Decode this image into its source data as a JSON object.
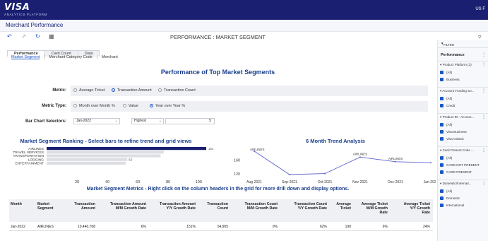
{
  "brand": {
    "logo": "VISA",
    "subtitle": "ANALYTICS PLATFORM",
    "user": "US F"
  },
  "subheader": {
    "title": "Merchant Performance"
  },
  "toolbar": {
    "back_icon": "undo-icon",
    "forward_icon": "redo-icon",
    "refresh_icon": "refresh-icon",
    "grid_icon": "grid-icon",
    "filter_icon": "funnel-icon"
  },
  "page": {
    "title": "PERFORMANCE : MARKET SEGMENT"
  },
  "tabs": [
    {
      "label": "Performance",
      "active": true
    },
    {
      "label": "Card Count",
      "active": false
    },
    {
      "label": "Data",
      "active": false
    }
  ],
  "subtabs": [
    {
      "label": "Market Segment",
      "active": true
    },
    {
      "label": "Merchant Category Code",
      "active": false
    },
    {
      "label": "Merchant",
      "active": false
    }
  ],
  "heading": "Performance of Top Market Segments",
  "controls": {
    "metric_label": "Metric:",
    "metric_options": [
      {
        "label": "Average Ticket",
        "selected": false
      },
      {
        "label": "Transaction Amount",
        "selected": true
      },
      {
        "label": "Transaction Count",
        "selected": false
      }
    ],
    "metric_type_label": "Metric Type:",
    "metric_type_options": [
      {
        "label": "Month over Month %",
        "selected": false
      },
      {
        "label": "Value",
        "selected": false
      },
      {
        "label": "Year over Year %",
        "selected": true
      }
    ],
    "bar_selectors_label": "Bar Chart Selectors:",
    "month_value": "Jan-2022",
    "order_value": "Highest",
    "count_value": "5"
  },
  "ranking": {
    "title": "Market Segment Ranking - Select bars to refine trend and grid views",
    "categories": [
      "AIRLINES",
      "TRAVEL SERVICES",
      "TRANSPORTATION",
      "LODGING",
      "ENTERTAINMENT"
    ],
    "values": [
      151,
      77,
      75,
      53,
      52
    ],
    "value_label": "151",
    "lodging_label": "53",
    "ticks": [
      "20",
      "40",
      "60",
      "80",
      "100"
    ],
    "xlim": [
      0,
      105
    ]
  },
  "trend": {
    "title": "6 Month Trend Analysis",
    "y_ticks": [
      "160",
      "120"
    ],
    "x_labels": [
      "Aug-2021",
      "Sep-2021",
      "Oct-2021",
      "Nov-2021",
      "Dec-2021",
      "Jan-2022"
    ],
    "values": [
      185,
      118,
      121,
      168,
      155,
      152
    ],
    "ylim": [
      110,
      195
    ],
    "point_labels": {
      "first": "AIRLINES",
      "nov": "AIRLINES",
      "dec": "AIRLINES"
    }
  },
  "metrics": {
    "title": "Market Segment Metrics - Right click on the column headers in the grid for more drill down and display options.",
    "headers": [
      [
        "Month"
      ],
      [
        "Market",
        "Segment"
      ],
      [
        "Transaction",
        "Amount"
      ],
      [
        "Transaction Amount",
        "M/M Growth Rate"
      ],
      [
        "Transaction Amount",
        "Y/Y Growth Rate"
      ],
      [
        "Transaction",
        "Count"
      ],
      [
        "Transaction Count",
        "M/M Growth Rate"
      ],
      [
        "Transaction Count",
        "Y/Y Growth Rate"
      ],
      [
        "Average",
        "Ticket"
      ],
      [
        "Average Ticket",
        "M/M Growth",
        "Rate"
      ],
      [
        "Average Ticket",
        "Y/Y Growth",
        "Rate"
      ]
    ],
    "rows": [
      [
        "Jan-2022",
        "AIRLINES",
        "10,440,768",
        "6%",
        "151%",
        "54,905",
        "0%",
        "62%",
        "190",
        "6%",
        "24%"
      ]
    ]
  },
  "filter": {
    "header": "FILTER",
    "section": "Performance",
    "groups": [
      {
        "title": "Product Platform (2)",
        "items": [
          "(All)",
          "Business"
        ]
      },
      {
        "title": "Account Funding So...",
        "items": [
          "(All)",
          "Credit"
        ]
      },
      {
        "title": "Product ID - Accoun...",
        "items": [
          "(All)",
          "Visa Business",
          "Visa Classic"
        ]
      },
      {
        "title": "Card Present Code ...",
        "items": [
          "(All)",
          "CARD NOT PRESENT",
          "CARD PRESENT"
        ]
      },
      {
        "title": "Domestic/Internati...",
        "items": [
          "(All)",
          "Domestic",
          "International"
        ]
      }
    ]
  },
  "colors": {
    "brand": "#1a1f71",
    "accent": "#1a56c6",
    "heading": "#1a3e8c",
    "bar_selected": "#1a1f71",
    "bar_other": "#dcdee3",
    "line": "#5b63c9"
  }
}
